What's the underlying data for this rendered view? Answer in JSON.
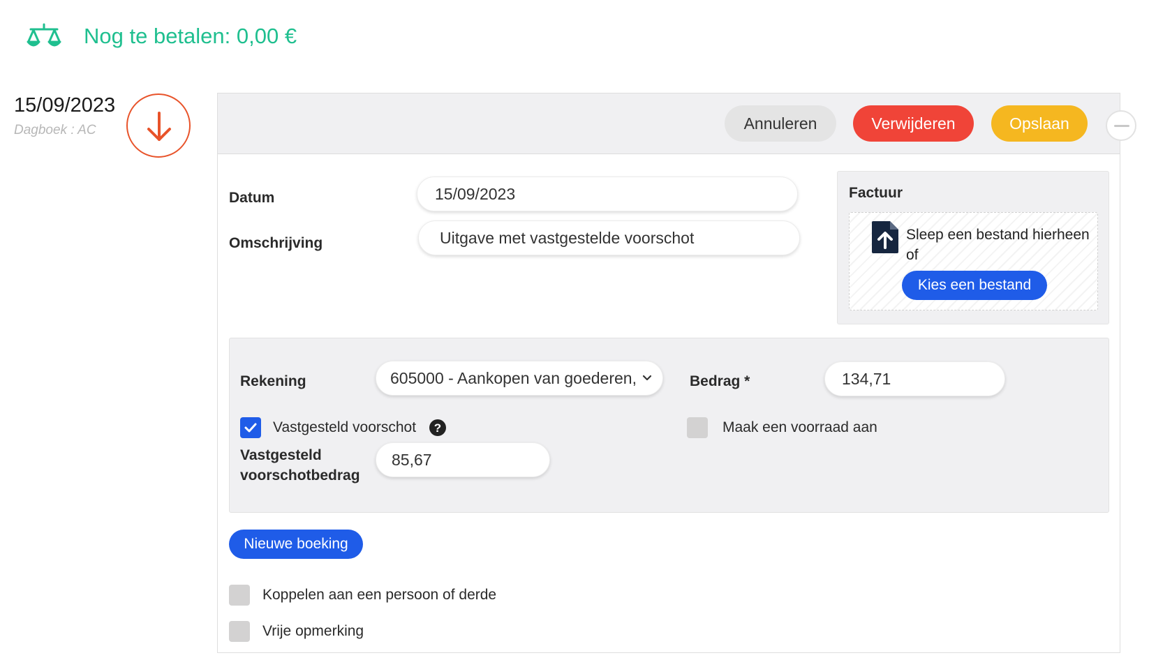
{
  "balance": {
    "icon": "balance-scale-icon",
    "text": "Nog te betalen: 0,00 €",
    "color": "#1fbf8f"
  },
  "entry": {
    "date": "15/09/2023",
    "journal": "Dagboek : AC",
    "direction_icon": "arrow-down-icon",
    "direction_color": "#e8532a"
  },
  "toolbar": {
    "cancel_label": "Annuleren",
    "delete_label": "Verwijderen",
    "save_label": "Opslaan",
    "collapse_icon": "minus-icon"
  },
  "form": {
    "datum_label": "Datum",
    "datum_value": "15/09/2023",
    "omschrijving_label": "Omschrijving",
    "omschrijving_value": "Uitgave met vastgestelde voorschot"
  },
  "factuur": {
    "title": "Factuur",
    "icon": "file-upload-icon",
    "drop_text": "Sleep een bestand hierheen of",
    "choose_label": "Kies een bestand"
  },
  "booking": {
    "rekening_label": "Rekening",
    "rekening_value": "605000 - Aankopen van goederen,",
    "bedrag_label": "Bedrag *",
    "bedrag_value": "134,71",
    "vastgesteld_label": "Vastgesteld voorschot",
    "vastgesteld_checked": true,
    "voorraad_label": "Maak een voorraad aan",
    "voorraad_checked": false,
    "voorschotbedrag_label_1": "Vastgesteld",
    "voorschotbedrag_label_2": "voorschotbedrag",
    "voorschotbedrag_value": "85,67"
  },
  "actions": {
    "new_booking_label": "Nieuwe boeking",
    "koppelen_label": "Koppelen aan een persoon of derde",
    "koppelen_checked": false,
    "opmerking_label": "Vrije opmerking",
    "opmerking_checked": false
  },
  "colors": {
    "primary_blue": "#1f5ce8",
    "delete_red": "#f04438",
    "save_yellow": "#f5b720"
  }
}
